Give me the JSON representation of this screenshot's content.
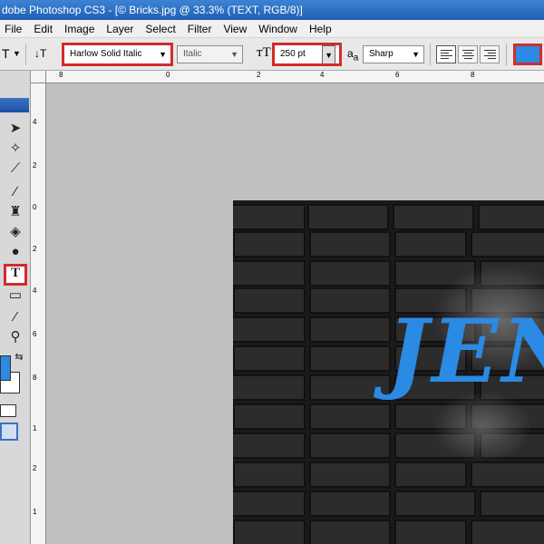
{
  "window": {
    "title": "dobe Photoshop CS3 - [© Bricks.jpg @ 33.3% (TEXT, RGB/8)]"
  },
  "menu": [
    "File",
    "Edit",
    "Image",
    "Layer",
    "Select",
    "Filter",
    "View",
    "Window",
    "Help"
  ],
  "options": {
    "font_family": "Harlow Solid Italic",
    "font_style": "Italic",
    "font_size": "250 pt",
    "antialias": "Sharp",
    "text_color": "#2a8ae4"
  },
  "ruler_h": [
    "8",
    "0",
    "2",
    "4",
    "6",
    "8"
  ],
  "ruler_v": [
    "4",
    "2",
    "0",
    "2",
    "4",
    "6",
    "8",
    "1",
    "2",
    "1"
  ],
  "canvas": {
    "text": "JEN",
    "text_color": "#2a8ae4"
  },
  "colors": {
    "foreground": "#2a8ae4",
    "background": "#ffffff",
    "highlight": "#d22c2c"
  }
}
